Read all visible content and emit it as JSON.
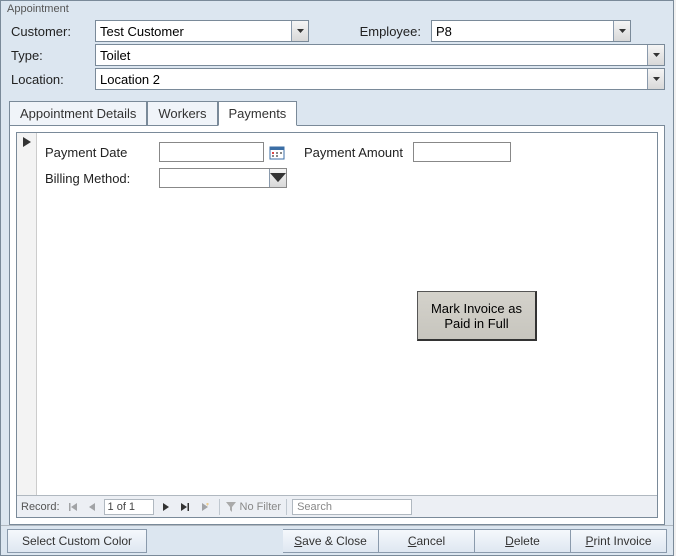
{
  "window": {
    "title": "Appointment"
  },
  "header": {
    "customer_label": "Customer:",
    "customer_value": "Test Customer",
    "employee_label": "Employee:",
    "employee_value": "P8",
    "type_label": "Type:",
    "type_value": "Toilet",
    "location_label": "Location:",
    "location_value": "Location 2"
  },
  "tabs": [
    {
      "label": "Appointment Details",
      "active": false
    },
    {
      "label": "Workers",
      "active": false
    },
    {
      "label": "Payments",
      "active": true
    }
  ],
  "payments": {
    "payment_date_label": "Payment Date",
    "payment_date_value": "",
    "payment_amount_label": "Payment Amount",
    "payment_amount_value": "",
    "billing_method_label": "Billing Method:",
    "billing_method_value": "",
    "mark_paid_button": "Mark Invoice as Paid in Full"
  },
  "nav": {
    "label": "Record:",
    "counter": "1 of 1",
    "filter_label": "No Filter",
    "search_placeholder": "Search"
  },
  "footer": {
    "select_color": "Select Custom Color",
    "save_close": "Save & Close",
    "cancel": "Cancel",
    "delete": "Delete",
    "print_invoice": "Print Invoice"
  }
}
